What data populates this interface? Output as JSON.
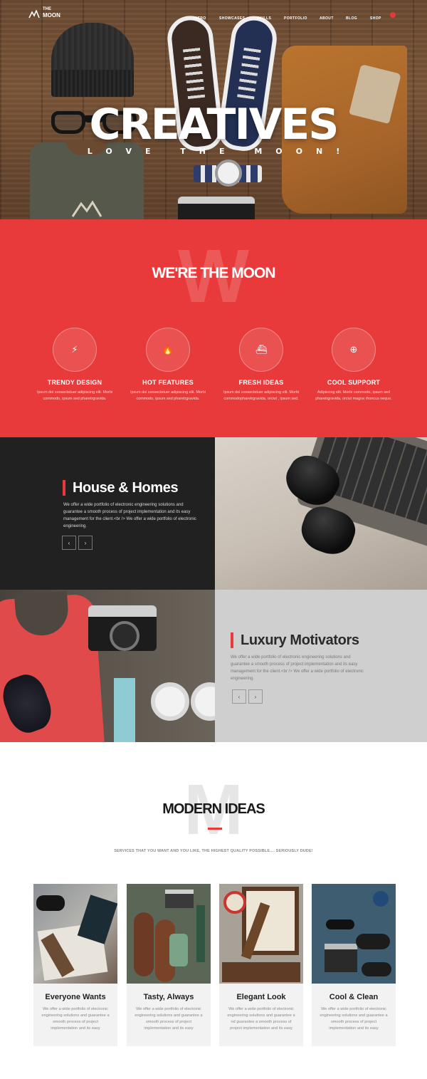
{
  "nav": {
    "logo_top": "THE",
    "logo_bottom": "MOON",
    "items": [
      "INTRO",
      "SHOWCASES",
      "SKILLS",
      "PORTFOLIO",
      "ABOUT",
      "BLOG",
      "SHOP"
    ]
  },
  "hero": {
    "title": "CREATIVES",
    "subtitle": "LOVE THE MOON!"
  },
  "about": {
    "watermark": "W",
    "heading": "WE'RE THE MOON",
    "features": [
      {
        "icon": "lightning-icon",
        "glyph": "⚡",
        "title": "TRENDY DESIGN",
        "desc": "Ipsum dol consectetuer adipiscing elit. Morbi commodo, ipsum sed pharetrgravida."
      },
      {
        "icon": "flame-icon",
        "glyph": "🔥",
        "title": "HOT FEATURES",
        "desc": "Ipsum dol consectetuer adipiscing elit. Morbi commodo, ipsum sed pharetrgravida."
      },
      {
        "icon": "ship-icon",
        "glyph": "⛴",
        "title": "FRESH IDEAS",
        "desc": "Ipsum dol consectetuer adipiscing elit. Morbi commodopharetrgravida, orciut , ipsum sed."
      },
      {
        "icon": "lifebuoy-icon",
        "glyph": "⊕",
        "title": "COOL SUPPORT",
        "desc": "Adipiscing elit. Morbi commodo, ipsum sed pharetrgravida, orciut magna rhoncus neque."
      }
    ]
  },
  "house": {
    "title": "House & Homes",
    "text": "We offer a wide portfolio of electronic engineering solutions and guarantee a smooth process of project implementation and its easy management for the client.<br /> We offer a wide portfolio of electronic engineering.",
    "prev": "‹",
    "next": "›"
  },
  "luxury": {
    "title": "Luxury Motivators",
    "text": "We offer a wide portfolio of electronic engineering solutions and guarantee a smooth process of project implementation and its easy management for the client.<br /> We offer a wide portfolio of electronic engineering.",
    "prev": "‹",
    "next": "›"
  },
  "ideas": {
    "watermark": "M",
    "heading": "MODERN IDEAS",
    "subtitle": "SERVICES THAT YOU WANT AND YOU LIKE, THE HIGHEST QUALITY POSSIBLE.... SERIOUSLY DUDE!",
    "cards": [
      {
        "title": "Everyone Wants",
        "desc": "We offer a wide portfolio of electronic engineering solutions and guarantee a smooth process of project implementation and its easy"
      },
      {
        "title": "Tasty, Always",
        "desc": "We offer a wide portfolio of electronic engineering solutions and guarantee a smooth process of project implementation and its easy"
      },
      {
        "title": "Elegant Look",
        "desc": "We offer a wide portfolio of electronic engineering solutions and guarantee a nd guarantee a smooth process of project implementation and its easy"
      },
      {
        "title": "Cool & Clean",
        "desc": "We offer a wide portfolio of electronic engineering solutions and guarantee a smooth process of project implementation and its easy"
      }
    ]
  },
  "colors": {
    "accent": "#e83a3a",
    "dark": "#212121",
    "light_gray": "#cfcfcf"
  }
}
